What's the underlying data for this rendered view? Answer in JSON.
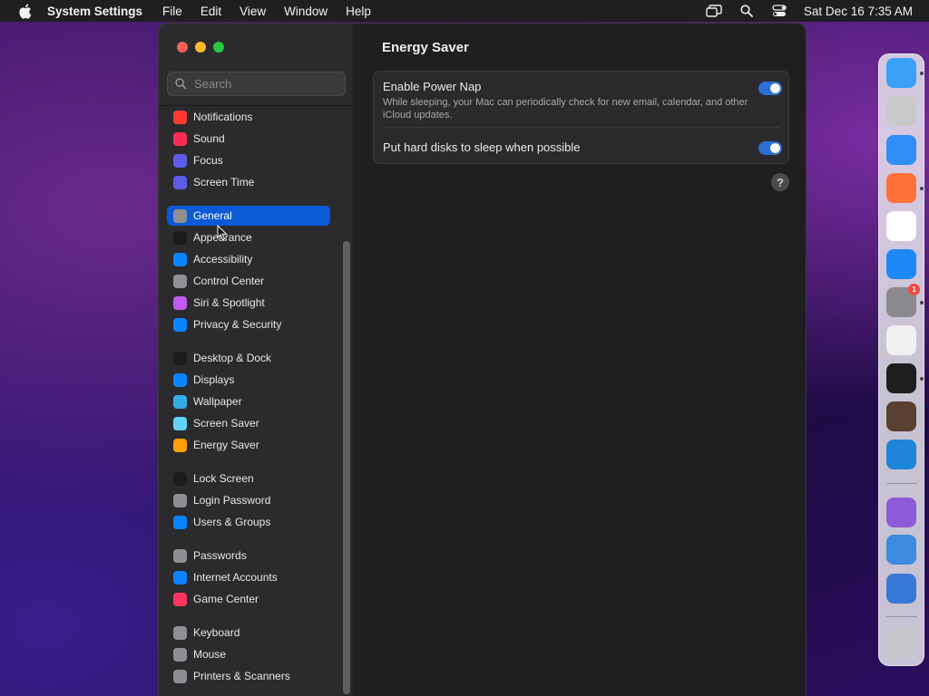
{
  "menubar": {
    "app_name": "System Settings",
    "items": [
      "File",
      "Edit",
      "View",
      "Window",
      "Help"
    ],
    "clock": "Sat Dec 16  7:35 AM"
  },
  "search": {
    "placeholder": "Search"
  },
  "sidebar": {
    "items": [
      {
        "label": "Notifications",
        "icon": "bell-icon",
        "color": "#ff3b30"
      },
      {
        "label": "Sound",
        "icon": "speaker-icon",
        "color": "#ff2d55"
      },
      {
        "label": "Focus",
        "icon": "moon-icon",
        "color": "#5e5ce6"
      },
      {
        "label": "Screen Time",
        "icon": "hourglass-icon",
        "color": "#5e5ce6"
      },
      {
        "label": "General",
        "icon": "gear-icon",
        "color": "#8e8e93",
        "selected": true
      },
      {
        "label": "Appearance",
        "icon": "appearance-icon",
        "color": "#1c1c1e"
      },
      {
        "label": "Accessibility",
        "icon": "accessibility-icon",
        "color": "#0a84ff"
      },
      {
        "label": "Control Center",
        "icon": "control-center-icon",
        "color": "#8e8e93"
      },
      {
        "label": "Siri & Spotlight",
        "icon": "siri-icon",
        "color": "#bf5af2"
      },
      {
        "label": "Privacy & Security",
        "icon": "hand-icon",
        "color": "#0a84ff"
      },
      {
        "label": "Desktop & Dock",
        "icon": "dock-icon",
        "color": "#1c1c1e"
      },
      {
        "label": "Displays",
        "icon": "sun-icon",
        "color": "#0a84ff"
      },
      {
        "label": "Wallpaper",
        "icon": "wallpaper-icon",
        "color": "#32ade6"
      },
      {
        "label": "Screen Saver",
        "icon": "screensaver-icon",
        "color": "#64d2ff"
      },
      {
        "label": "Energy Saver",
        "icon": "bulb-icon",
        "color": "#ff9f0a"
      },
      {
        "label": "Lock Screen",
        "icon": "lock-icon",
        "color": "#1c1c1e"
      },
      {
        "label": "Login Password",
        "icon": "key-icon",
        "color": "#8e8e93"
      },
      {
        "label": "Users & Groups",
        "icon": "users-icon",
        "color": "#0a84ff"
      },
      {
        "label": "Passwords",
        "icon": "key-icon",
        "color": "#8e8e93"
      },
      {
        "label": "Internet Accounts",
        "icon": "at-icon",
        "color": "#0a84ff"
      },
      {
        "label": "Game Center",
        "icon": "game-center-icon",
        "color": "#ff375f"
      },
      {
        "label": "Keyboard",
        "icon": "keyboard-icon",
        "color": "#8e8e93"
      },
      {
        "label": "Mouse",
        "icon": "mouse-icon",
        "color": "#8e8e93"
      },
      {
        "label": "Printers & Scanners",
        "icon": "printer-icon",
        "color": "#8e8e93"
      }
    ]
  },
  "content": {
    "title": "Energy Saver",
    "settings": [
      {
        "title": "Enable Power Nap",
        "description": "While sleeping, your Mac can periodically check for new email, calendar, and other iCloud updates.",
        "enabled": true
      },
      {
        "title": "Put hard disks to sleep when possible",
        "description": "",
        "enabled": true
      }
    ],
    "help_label": "?"
  },
  "dock": {
    "apps": [
      {
        "name": "finder-icon",
        "color": "#3aa0f5",
        "running": true
      },
      {
        "name": "launchpad-icon",
        "color": "#c9c9c9",
        "running": false
      },
      {
        "name": "safari-icon",
        "color": "#2f8ef5",
        "running": false
      },
      {
        "name": "firefox-icon",
        "color": "#ff7139",
        "running": true
      },
      {
        "name": "chrome-icon",
        "color": "#ffffff",
        "running": false
      },
      {
        "name": "app-store-icon",
        "color": "#1e88f7",
        "running": false
      },
      {
        "name": "system-settings-icon",
        "color": "#8a8a8e",
        "running": true,
        "badge": "1"
      },
      {
        "name": "textedit-icon",
        "color": "#f0f0f0",
        "running": false
      },
      {
        "name": "terminal-icon",
        "color": "#1e1e1e",
        "running": true
      },
      {
        "name": "garageband-icon",
        "color": "#5a4030",
        "running": false
      },
      {
        "name": "vscode-icon",
        "color": "#1e84d8",
        "running": false
      },
      {
        "name": "visual-studio-icon",
        "color": "#8e5bd8",
        "running": false
      },
      {
        "name": "weather-icon",
        "color": "#3c8be0",
        "running": false
      },
      {
        "name": "chromium-icon",
        "color": "#3a78d8",
        "running": false
      },
      {
        "name": "trash-icon",
        "color": "#c7c7cc",
        "running": false
      }
    ]
  }
}
